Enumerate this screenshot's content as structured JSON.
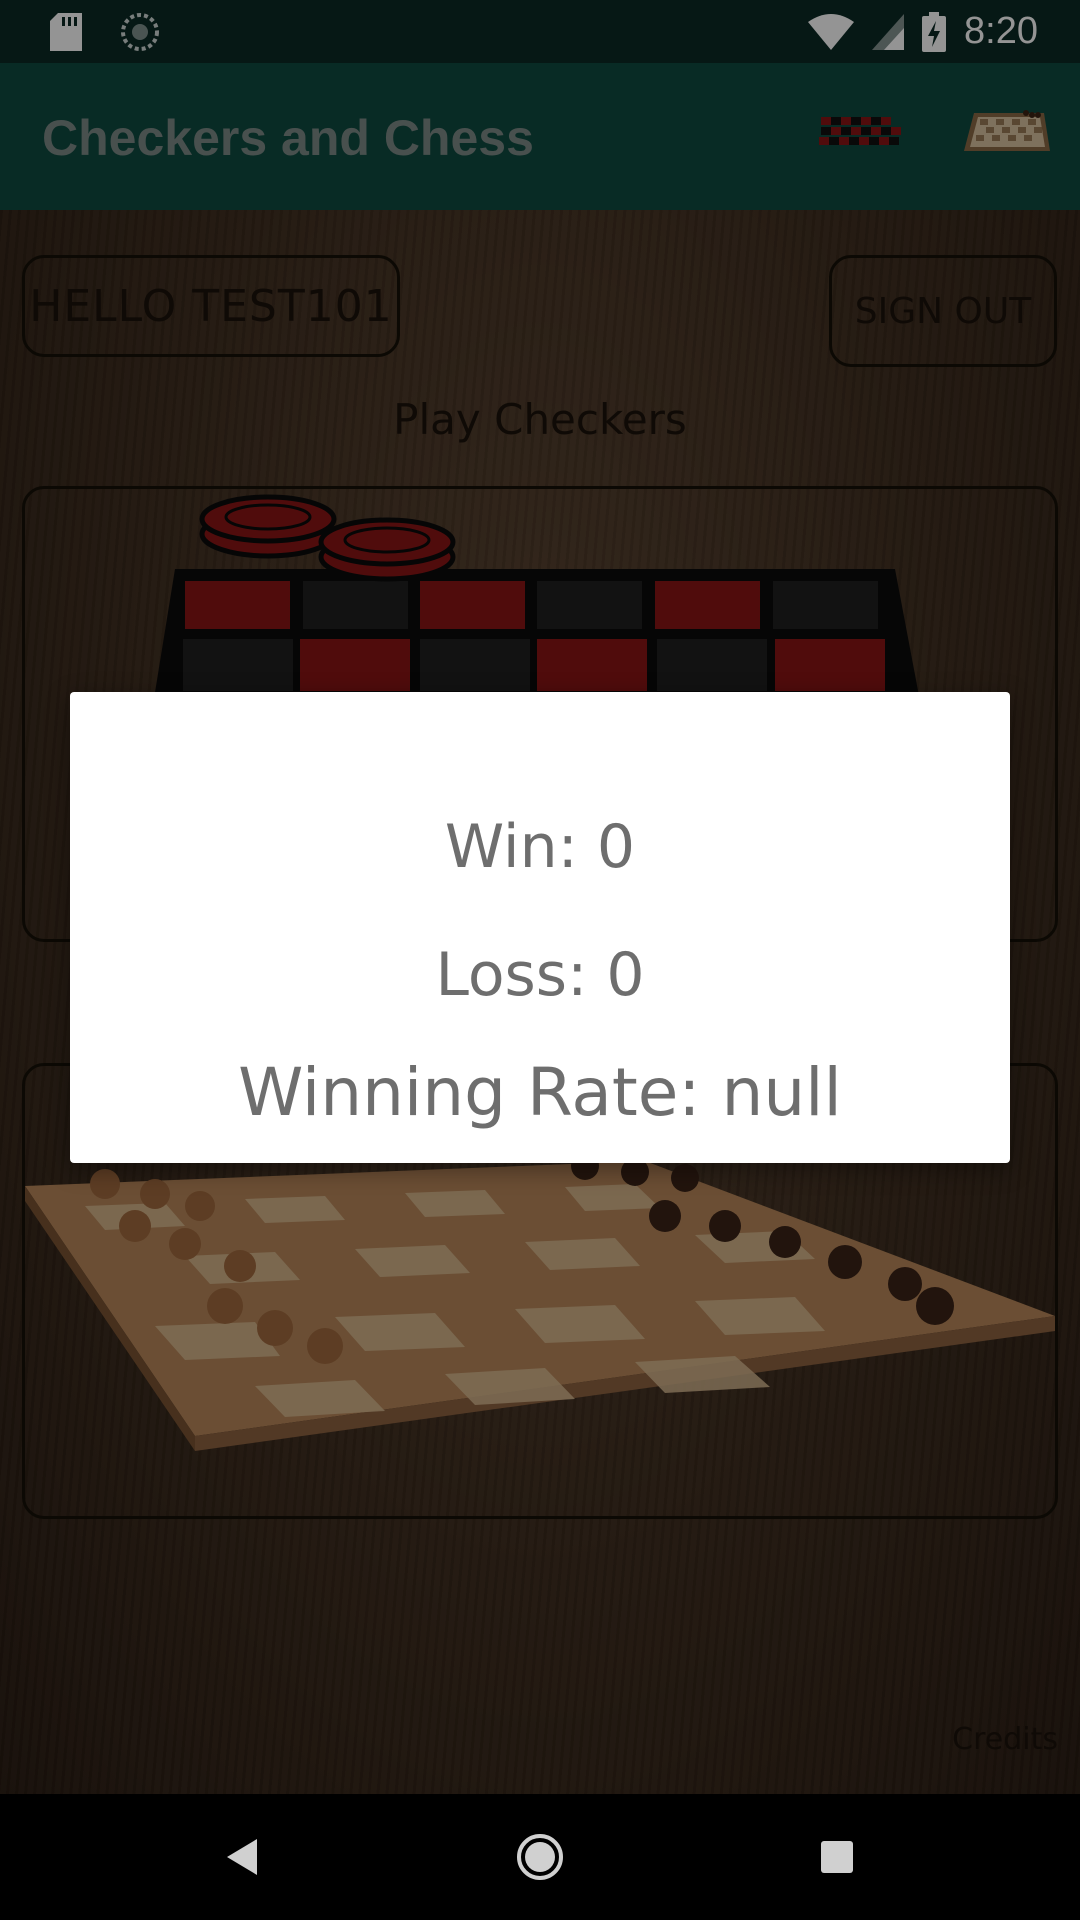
{
  "status_bar": {
    "time": "8:20",
    "icons": [
      "sd-card-icon",
      "sync-icon",
      "wifi-icon",
      "signal-icon",
      "battery-charging-icon"
    ]
  },
  "app_bar": {
    "title": "Checkers and Chess",
    "actions": [
      "checkers-board-icon",
      "chess-board-icon"
    ]
  },
  "main": {
    "greeting": "HELLO TEST101",
    "sign_out_label": "SIGN OUT",
    "play_checkers_label": "Play Checkers",
    "credits_label": "Credits"
  },
  "dialog": {
    "win": "Win: 0",
    "loss": "Loss: 0",
    "winning_rate": "Winning Rate: null"
  },
  "colors": {
    "status_bar": "#0b2a25",
    "app_bar": "#0f4a40",
    "checker_red": "#8a1515",
    "dialog_text": "#6e6e6e"
  }
}
